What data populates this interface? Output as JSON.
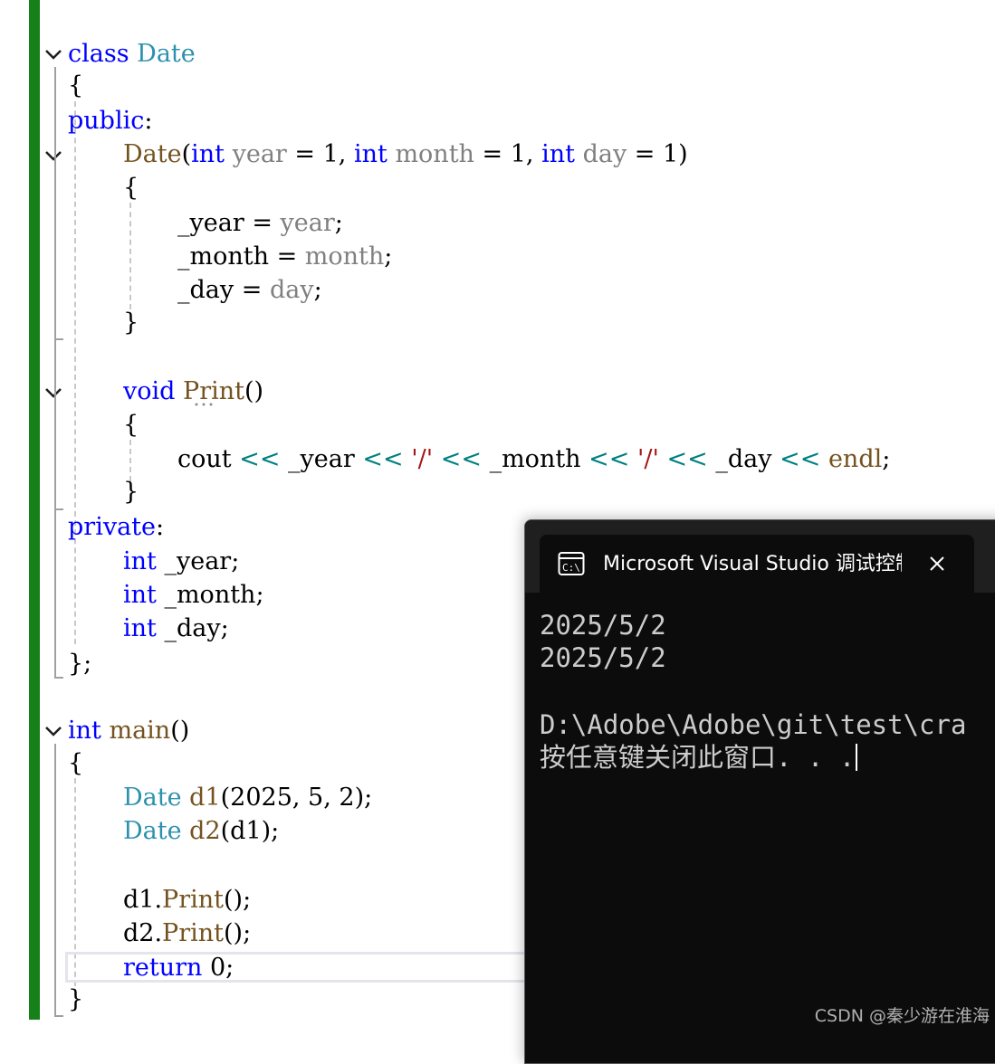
{
  "editor": {
    "lines": {
      "l1": [
        {
          "t": "class",
          "c": "kw"
        },
        {
          "t": " "
        },
        {
          "t": "Date",
          "c": "ty"
        }
      ],
      "l2": [
        {
          "t": "{"
        }
      ],
      "l3": [
        {
          "t": "public",
          "c": "kw"
        },
        {
          "t": ":"
        }
      ],
      "l4": [
        {
          "t": "Date",
          "c": "fn"
        },
        {
          "t": "("
        },
        {
          "t": "int",
          "c": "kw"
        },
        {
          "t": " "
        },
        {
          "t": "year",
          "c": "pa"
        },
        {
          "t": " = 1, "
        },
        {
          "t": "int",
          "c": "kw"
        },
        {
          "t": " "
        },
        {
          "t": "month",
          "c": "pa"
        },
        {
          "t": " = 1, "
        },
        {
          "t": "int",
          "c": "kw"
        },
        {
          "t": " "
        },
        {
          "t": "day",
          "c": "pa"
        },
        {
          "t": " = 1)"
        }
      ],
      "l5": [
        {
          "t": "{"
        }
      ],
      "l6": [
        {
          "t": "_year = "
        },
        {
          "t": "year",
          "c": "pa"
        },
        {
          "t": ";"
        }
      ],
      "l7": [
        {
          "t": "_month = "
        },
        {
          "t": "month",
          "c": "pa"
        },
        {
          "t": ";"
        }
      ],
      "l8": [
        {
          "t": "_day = "
        },
        {
          "t": "day",
          "c": "pa"
        },
        {
          "t": ";"
        }
      ],
      "l9": [
        {
          "t": "}"
        }
      ],
      "l10": [
        {
          "t": "void",
          "c": "kw"
        },
        {
          "t": " "
        },
        {
          "t": "Print",
          "c": "fn"
        },
        {
          "t": "()"
        }
      ],
      "l11": [
        {
          "t": "{"
        }
      ],
      "l12": [
        {
          "t": "cout "
        },
        {
          "t": "<<",
          "c": "op"
        },
        {
          "t": " _year "
        },
        {
          "t": "<<",
          "c": "op"
        },
        {
          "t": " "
        },
        {
          "t": "'/'",
          "c": "st"
        },
        {
          "t": " "
        },
        {
          "t": "<<",
          "c": "op"
        },
        {
          "t": " _month "
        },
        {
          "t": "<<",
          "c": "op"
        },
        {
          "t": " "
        },
        {
          "t": "'/'",
          "c": "st"
        },
        {
          "t": " "
        },
        {
          "t": "<<",
          "c": "op"
        },
        {
          "t": " _day "
        },
        {
          "t": "<<",
          "c": "op"
        },
        {
          "t": " "
        },
        {
          "t": "endl",
          "c": "fn"
        },
        {
          "t": ";"
        }
      ],
      "l13": [
        {
          "t": "}"
        }
      ],
      "l14": [
        {
          "t": "private",
          "c": "kw"
        },
        {
          "t": ":"
        }
      ],
      "l15": [
        {
          "t": "int",
          "c": "kw"
        },
        {
          "t": " _year;"
        }
      ],
      "l16": [
        {
          "t": "int",
          "c": "kw"
        },
        {
          "t": " _month;"
        }
      ],
      "l17": [
        {
          "t": "int",
          "c": "kw"
        },
        {
          "t": " _day;"
        }
      ],
      "l18": [
        {
          "t": "};"
        }
      ],
      "l19": [
        {
          "t": "int",
          "c": "kw"
        },
        {
          "t": " "
        },
        {
          "t": "main",
          "c": "fn"
        },
        {
          "t": "()"
        }
      ],
      "l20": [
        {
          "t": "{"
        }
      ],
      "l21": [
        {
          "t": "Date",
          "c": "ty"
        },
        {
          "t": " "
        },
        {
          "t": "d1",
          "c": "fn"
        },
        {
          "t": "(2025, 5, 2);"
        }
      ],
      "l22": [
        {
          "t": "Date",
          "c": "ty"
        },
        {
          "t": " "
        },
        {
          "t": "d2",
          "c": "fn"
        },
        {
          "t": "(d1);"
        }
      ],
      "l23": [
        {
          "t": "d1."
        },
        {
          "t": "Print",
          "c": "fn"
        },
        {
          "t": "();"
        }
      ],
      "l24": [
        {
          "t": "d2."
        },
        {
          "t": "Print",
          "c": "fn"
        },
        {
          "t": "();"
        }
      ],
      "l25": [
        {
          "t": "return",
          "c": "kw"
        },
        {
          "t": " 0;"
        }
      ],
      "l26": [
        {
          "t": "}"
        }
      ]
    }
  },
  "console": {
    "title": "Microsoft Visual Studio 调试控制台",
    "icon": "terminal-icon",
    "icon_text": "C:\\",
    "output": [
      "2025/5/2",
      "2025/5/2",
      "",
      "D:\\Adobe\\Adobe\\git\\test\\cra",
      "按任意键关闭此窗口. . ."
    ]
  },
  "watermark": "CSDN @秦少游在淮海",
  "colors": {
    "keyword": "#0000ff",
    "type": "#2b91af",
    "function": "#74531f",
    "parameter": "#808080",
    "string": "#a31515",
    "operator": "#008080",
    "change_bar": "#168019",
    "console_bg": "#0c0c0c"
  }
}
